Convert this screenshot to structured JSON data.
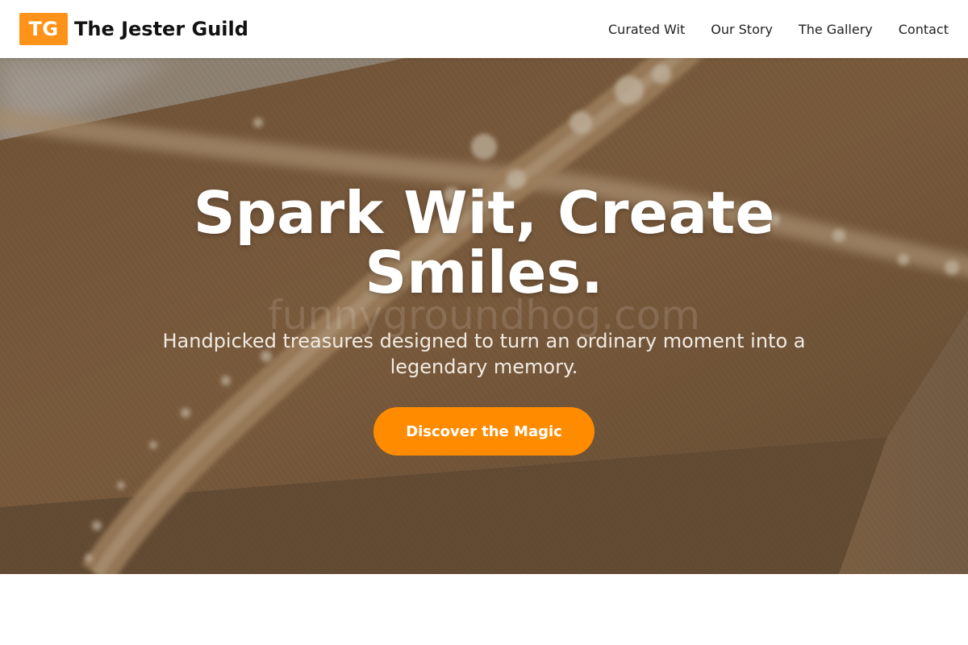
{
  "brand": {
    "logo_text": "TG",
    "name": "The Jester Guild"
  },
  "nav": {
    "items": [
      {
        "label": "Curated Wit"
      },
      {
        "label": "Our Story"
      },
      {
        "label": "The Gallery"
      },
      {
        "label": "Contact"
      }
    ]
  },
  "hero": {
    "title": "Spark Wit, Create Smiles.",
    "watermark": "funnygroundhog.com",
    "subtitle": "Handpicked treasures designed to turn an ordinary moment into a legendary memory.",
    "cta_label": "Discover the Magic",
    "background_icon": "gift-box-photo-icon"
  },
  "colors": {
    "accent": "#ff8c00",
    "logo_bg": "#ff9319",
    "header_bg": "#ffffff",
    "text_dark": "#111111"
  }
}
